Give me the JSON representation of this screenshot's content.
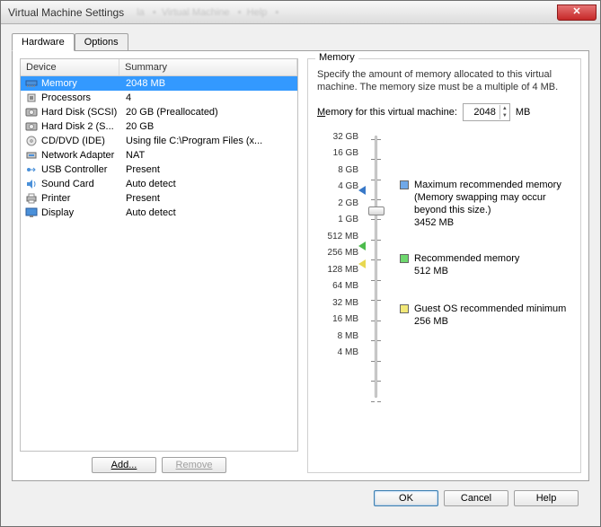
{
  "window": {
    "title": "Virtual Machine Settings"
  },
  "tabs": {
    "hardware": "Hardware",
    "options": "Options"
  },
  "list": {
    "head_device": "Device",
    "head_summary": "Summary",
    "rows": [
      {
        "device": "Memory",
        "summary": "2048 MB",
        "selected": true,
        "icon": "memory"
      },
      {
        "device": "Processors",
        "summary": "4",
        "icon": "cpu"
      },
      {
        "device": "Hard Disk (SCSI)",
        "summary": "20 GB (Preallocated)",
        "icon": "hdd"
      },
      {
        "device": "Hard Disk 2 (S...",
        "summary": "20 GB",
        "icon": "hdd"
      },
      {
        "device": "CD/DVD (IDE)",
        "summary": "Using file C:\\Program Files (x...",
        "icon": "cd"
      },
      {
        "device": "Network Adapter",
        "summary": "NAT",
        "icon": "net"
      },
      {
        "device": "USB Controller",
        "summary": "Present",
        "icon": "usb"
      },
      {
        "device": "Sound Card",
        "summary": "Auto detect",
        "icon": "sound"
      },
      {
        "device": "Printer",
        "summary": "Present",
        "icon": "printer"
      },
      {
        "device": "Display",
        "summary": "Auto detect",
        "icon": "display"
      }
    ]
  },
  "buttons": {
    "add": "Add...",
    "remove": "Remove",
    "ok": "OK",
    "cancel": "Cancel",
    "help": "Help"
  },
  "memory": {
    "group_title": "Memory",
    "desc": "Specify the amount of memory allocated to this virtual machine. The memory size must be a multiple of 4 MB.",
    "input_label_pre": "Memory for this virtual machine:",
    "input_label_u": "M",
    "value": "2048",
    "unit": "MB",
    "ticks": [
      "32 GB",
      "16 GB",
      "8 GB",
      "4 GB",
      "2 GB",
      "1 GB",
      "512 MB",
      "256 MB",
      "128 MB",
      "64 MB",
      "32 MB",
      "16 MB",
      "8 MB",
      "4 MB"
    ],
    "legend": {
      "max": {
        "title": "Maximum recommended memory",
        "note": "(Memory swapping may occur beyond this size.)",
        "value": "3452 MB"
      },
      "rec": {
        "title": "Recommended memory",
        "value": "512 MB"
      },
      "min": {
        "title": "Guest OS recommended minimum",
        "value": "256 MB"
      }
    }
  }
}
